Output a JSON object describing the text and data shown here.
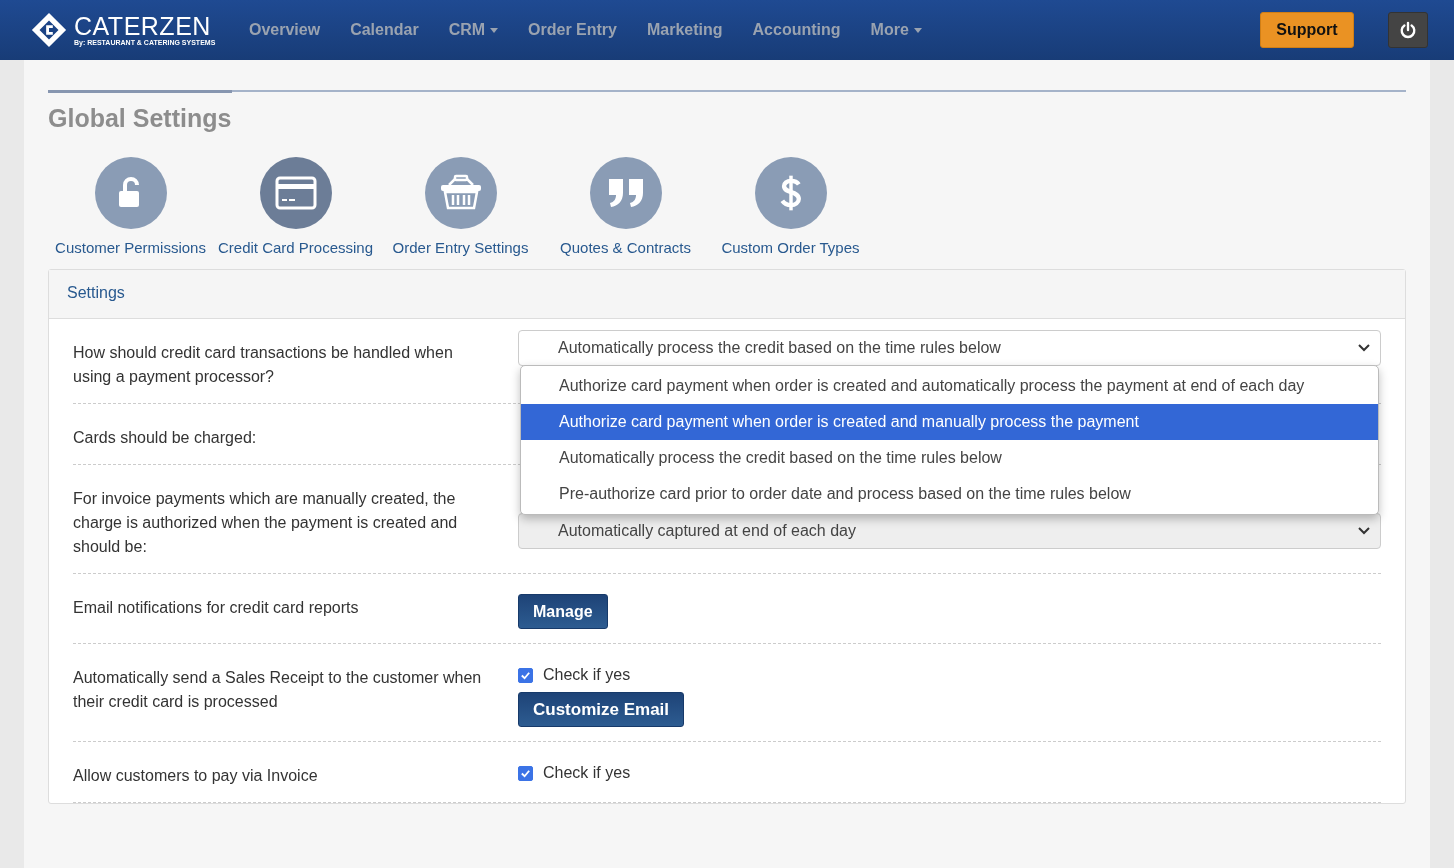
{
  "brand": {
    "name": "CATERZEN",
    "tagline": "By: RESTAURANT & CATERING SYSTEMS"
  },
  "nav": [
    {
      "label": "Overview",
      "caret": false
    },
    {
      "label": "Calendar",
      "caret": false
    },
    {
      "label": "CRM",
      "caret": true
    },
    {
      "label": "Order Entry",
      "caret": false
    },
    {
      "label": "Marketing",
      "caret": false
    },
    {
      "label": "Accounting",
      "caret": false
    },
    {
      "label": "More",
      "caret": true
    }
  ],
  "support_button": "Support",
  "page_title": "Global Settings",
  "sections": [
    {
      "label": "Customer Permissions",
      "selected": false
    },
    {
      "label": "Credit Card Processing",
      "selected": true
    },
    {
      "label": "Order Entry Settings",
      "selected": false
    },
    {
      "label": "Quotes & Contracts",
      "selected": false
    },
    {
      "label": "Custom Order Types",
      "selected": false
    }
  ],
  "panel": {
    "title": "Settings",
    "rows": [
      {
        "label": "How should credit card transactions be handled when using a payment processor?",
        "kind": "select",
        "value": "Automatically process the credit based on the time rules below",
        "options": [
          {
            "label": "Authorize card payment when order is created and automatically process the payment at end of each day",
            "highlighted": false
          },
          {
            "label": "Authorize card payment when order is created and manually process the payment",
            "highlighted": true
          },
          {
            "label": "Automatically process the credit based on the time rules below",
            "highlighted": false
          },
          {
            "label": "Pre-authorize card prior to order date and process based on the time rules below",
            "highlighted": false
          }
        ]
      },
      {
        "label": "Cards should be charged:",
        "kind": "covered"
      },
      {
        "label": "For invoice payments which are manually created, the charge is authorized when the payment is created and should be:",
        "kind": "select",
        "value": "Automatically captured at end of each day"
      },
      {
        "label": "Email notifications for credit card reports",
        "kind": "button",
        "button": "Manage"
      },
      {
        "label": "Automatically send a Sales Receipt to the customer when their credit card is processed",
        "kind": "checkbox_button",
        "checkbox": "Check if yes",
        "checked": true,
        "button": "Customize Email"
      },
      {
        "label": "Allow customers to pay via Invoice",
        "kind": "checkbox",
        "checkbox": "Check if yes",
        "checked": true
      }
    ]
  }
}
